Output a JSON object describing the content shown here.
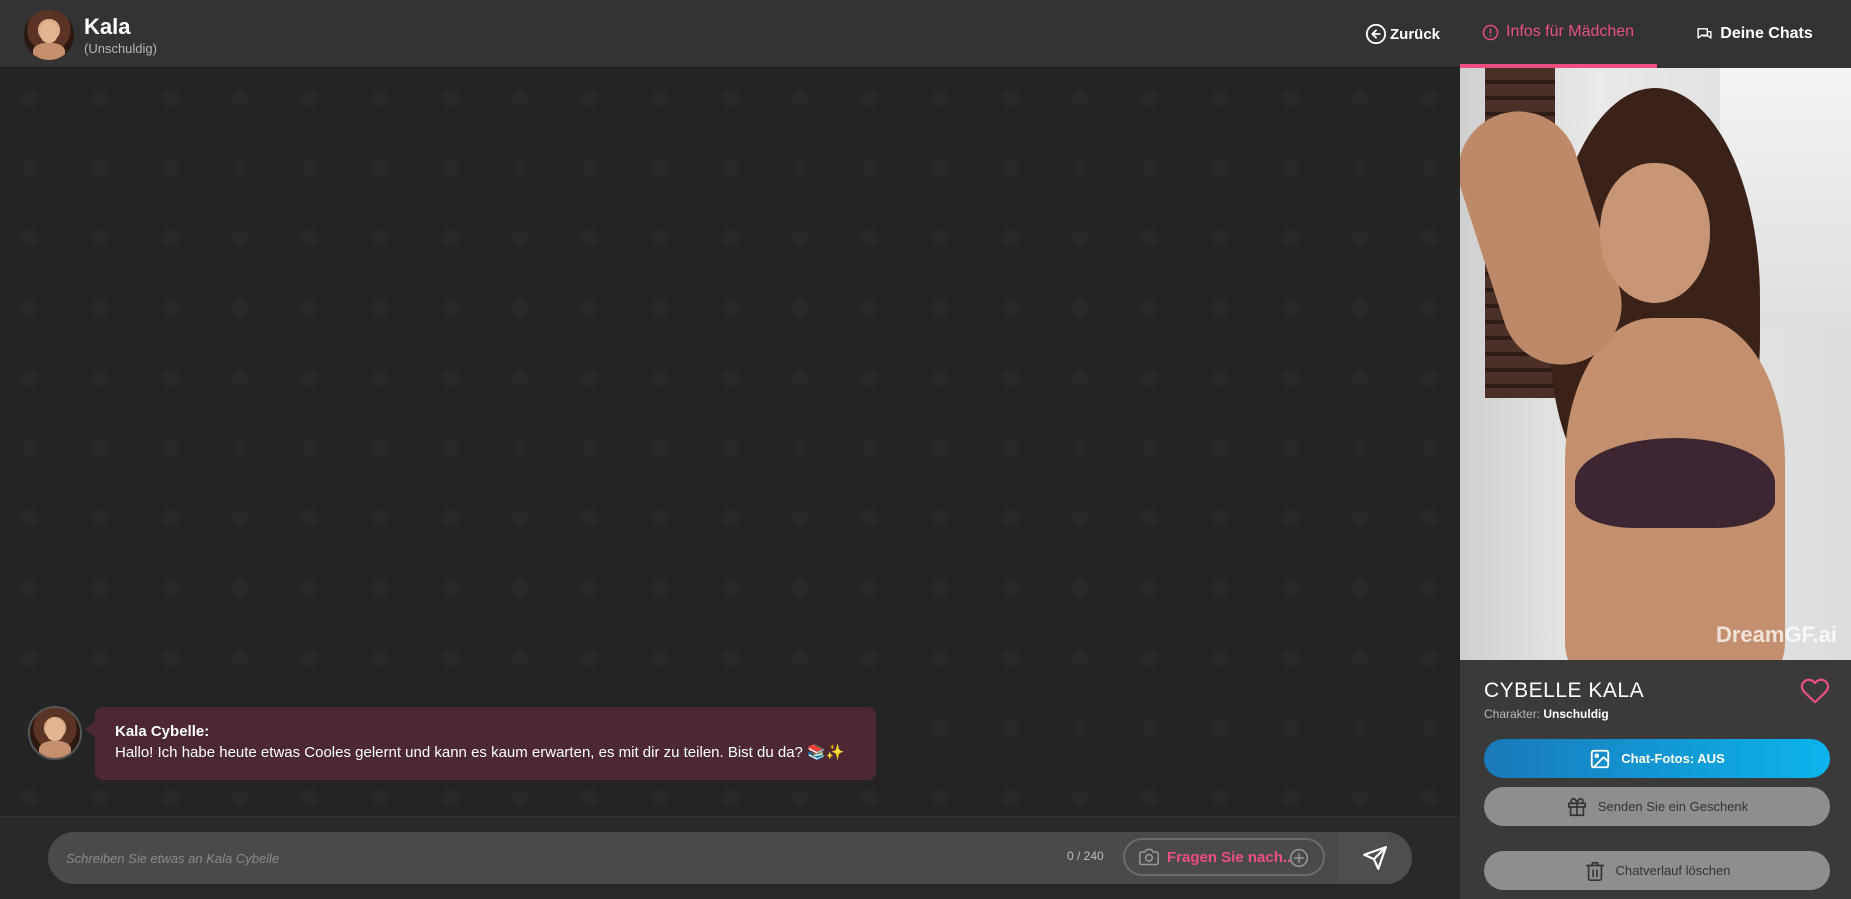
{
  "header": {
    "name": "Kala",
    "character": "(Unschuldig)",
    "back_label": "Zurück"
  },
  "tabs": {
    "info_label": "Infos für Mädchen",
    "chats_label": "Deine Chats"
  },
  "messages": [
    {
      "sender": "Kala Cybelle:",
      "text": "Hallo! Ich habe heute etwas Cooles gelernt und kann es kaum erwarten, es mit dir zu teilen. Bist du da? 📚✨"
    }
  ],
  "composer": {
    "placeholder": "Schreiben Sie etwas an Kala Cybelle",
    "char_count": "0 / 240",
    "ask_label": "Fragen Sie nach..",
    "icons": [
      "camera-icon",
      "plus-circle-icon",
      "send-icon"
    ]
  },
  "profile": {
    "name": "CYBELLE KALA",
    "character_label": "Charakter:",
    "character_value": "Unschuldig",
    "photo_watermark": "DreamGF.ai"
  },
  "actions": {
    "chat_photos_label": "Chat-Fotos:  AUS",
    "gift_label": "Senden Sie ein Geschenk",
    "clear_label": "Chatverlauf löschen"
  },
  "colors": {
    "accent": "#ec4f84",
    "bubble": "#4c2832",
    "photos_gradient_start": "#1a79b9",
    "photos_gradient_end": "#0bb4eb"
  }
}
